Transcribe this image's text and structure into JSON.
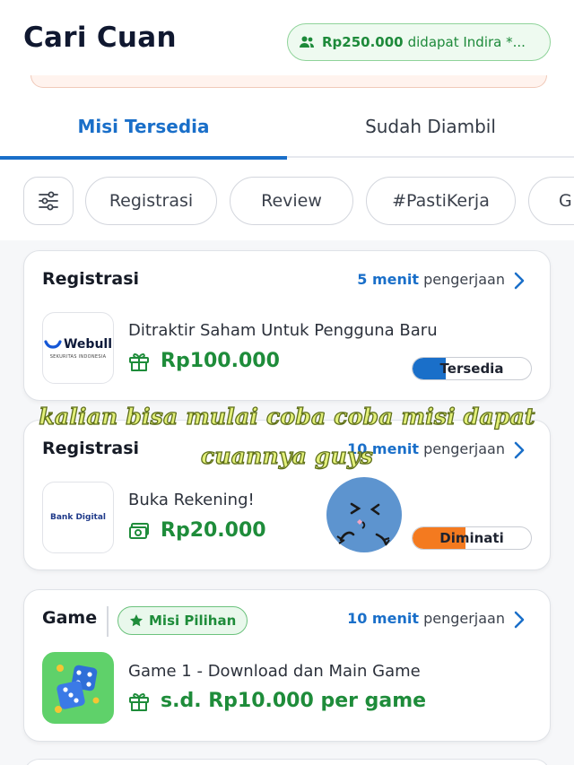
{
  "header": {
    "title": "Cari Cuan",
    "earning_amount": "Rp250.000",
    "earning_text": "didapat Indira *..."
  },
  "tabs": [
    {
      "label": "Misi Tersedia",
      "active": true
    },
    {
      "label": "Sudah Diambil",
      "active": false
    }
  ],
  "filters": {
    "chips": [
      "Registrasi",
      "Review",
      "#PastiKerja",
      "G"
    ]
  },
  "missions": [
    {
      "category": "Registrasi",
      "time_value": "5 menit",
      "time_suffix": "pengerjaan",
      "logo_brand": "Webull",
      "logo_sub": "SEKURITAS INDONESIA",
      "title": "Ditraktir Saham Untuk Pengguna Baru",
      "reward": "Rp100.000",
      "reward_icon": "gift-icon",
      "status": "Tersedia",
      "status_level": 0.28,
      "status_color": "#1a6fc9"
    },
    {
      "category": "Registrasi",
      "time_value": "10 menit",
      "time_suffix": "pengerjaan",
      "logo_brand": "Bank Digital",
      "title": "Buka Rekening!",
      "reward": "Rp20.000",
      "reward_icon": "cash-icon",
      "status": "Diminati",
      "status_level": 0.45,
      "status_color": "#f47a1f"
    },
    {
      "category": "Game",
      "badge": "Misi Pilihan",
      "time_value": "10 menit",
      "time_suffix": "pengerjaan",
      "logo_brand": "dice-game",
      "title": "Game 1 - Download dan Main Game",
      "reward": "s.d. Rp10.000 per game",
      "reward_icon": "gift-icon"
    }
  ],
  "overlay": {
    "line1": "kalian bisa mulai coba coba misi dapat",
    "line2": "cuannya guys"
  },
  "colors": {
    "accent_blue": "#1a6fc9",
    "reward_green": "#1e8c3a",
    "orange": "#f47a1f"
  }
}
